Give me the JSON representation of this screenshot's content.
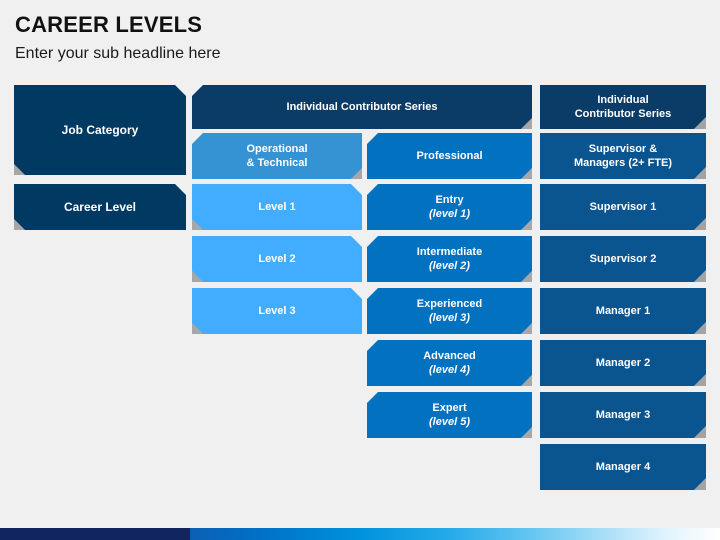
{
  "header": {
    "title": "CAREER LEVELS",
    "subtitle": "Enter your sub headline here"
  },
  "colors": {
    "background": "#f0f0f0",
    "navy": "#003a63",
    "header_band": "#0b3c67",
    "light_blue": "#3593d4",
    "sky_blue": "#42acff",
    "mid_blue": "#0271bf",
    "deep_blue": "#0a5490",
    "ribbon_navy": "#112561",
    "title_text": "#111111"
  },
  "row_labels": [
    {
      "id": "job-category",
      "label": "Job Category"
    },
    {
      "id": "career-level",
      "label": "Career Level"
    }
  ],
  "series_headers": [
    {
      "id": "individual-contributor-series-left",
      "label": "Individual Contributor Series",
      "spans": 2
    },
    {
      "id": "individual-contributor-series-right",
      "label": "Individual\nContributor Series",
      "line1": "Individual",
      "line2": "Contributor Series",
      "spans": 1
    }
  ],
  "sub_headers": [
    {
      "id": "operational-technical",
      "line1": "Operational",
      "line2": "& Technical",
      "color": "#3593d4"
    },
    {
      "id": "professional",
      "line1": "Professional",
      "line2": "",
      "color": "#0271bf"
    },
    {
      "id": "supervisor-managers",
      "line1": "Supervisor &",
      "line2": "Managers (2+ FTE)",
      "color": "#0a5490"
    }
  ],
  "columns": [
    {
      "id": "operational-technical-column",
      "color": "#42acff",
      "cells": [
        {
          "id": "level-1",
          "title": "Level 1",
          "sub": ""
        },
        {
          "id": "level-2",
          "title": "Level 2",
          "sub": ""
        },
        {
          "id": "level-3",
          "title": "Level 3",
          "sub": ""
        }
      ]
    },
    {
      "id": "professional-column",
      "color": "#0271bf",
      "cells": [
        {
          "id": "entry",
          "title": "Entry",
          "sub": "(level 1)"
        },
        {
          "id": "intermediate",
          "title": "Intermediate",
          "sub": "(level 2)"
        },
        {
          "id": "experienced",
          "title": "Experienced",
          "sub": "(level 3)"
        },
        {
          "id": "advanced",
          "title": "Advanced",
          "sub": "(level 4)"
        },
        {
          "id": "expert",
          "title": "Expert",
          "sub": "(level 5)"
        }
      ]
    },
    {
      "id": "supervisor-managers-column",
      "color": "#0a5490",
      "cells": [
        {
          "id": "supervisor-1",
          "title": "Supervisor 1",
          "sub": ""
        },
        {
          "id": "supervisor-2",
          "title": "Supervisor 2",
          "sub": ""
        },
        {
          "id": "manager-1",
          "title": "Manager 1",
          "sub": ""
        },
        {
          "id": "manager-2",
          "title": "Manager 2",
          "sub": ""
        },
        {
          "id": "manager-3",
          "title": "Manager 3",
          "sub": ""
        },
        {
          "id": "manager-4",
          "title": "Manager 4",
          "sub": ""
        }
      ]
    }
  ]
}
